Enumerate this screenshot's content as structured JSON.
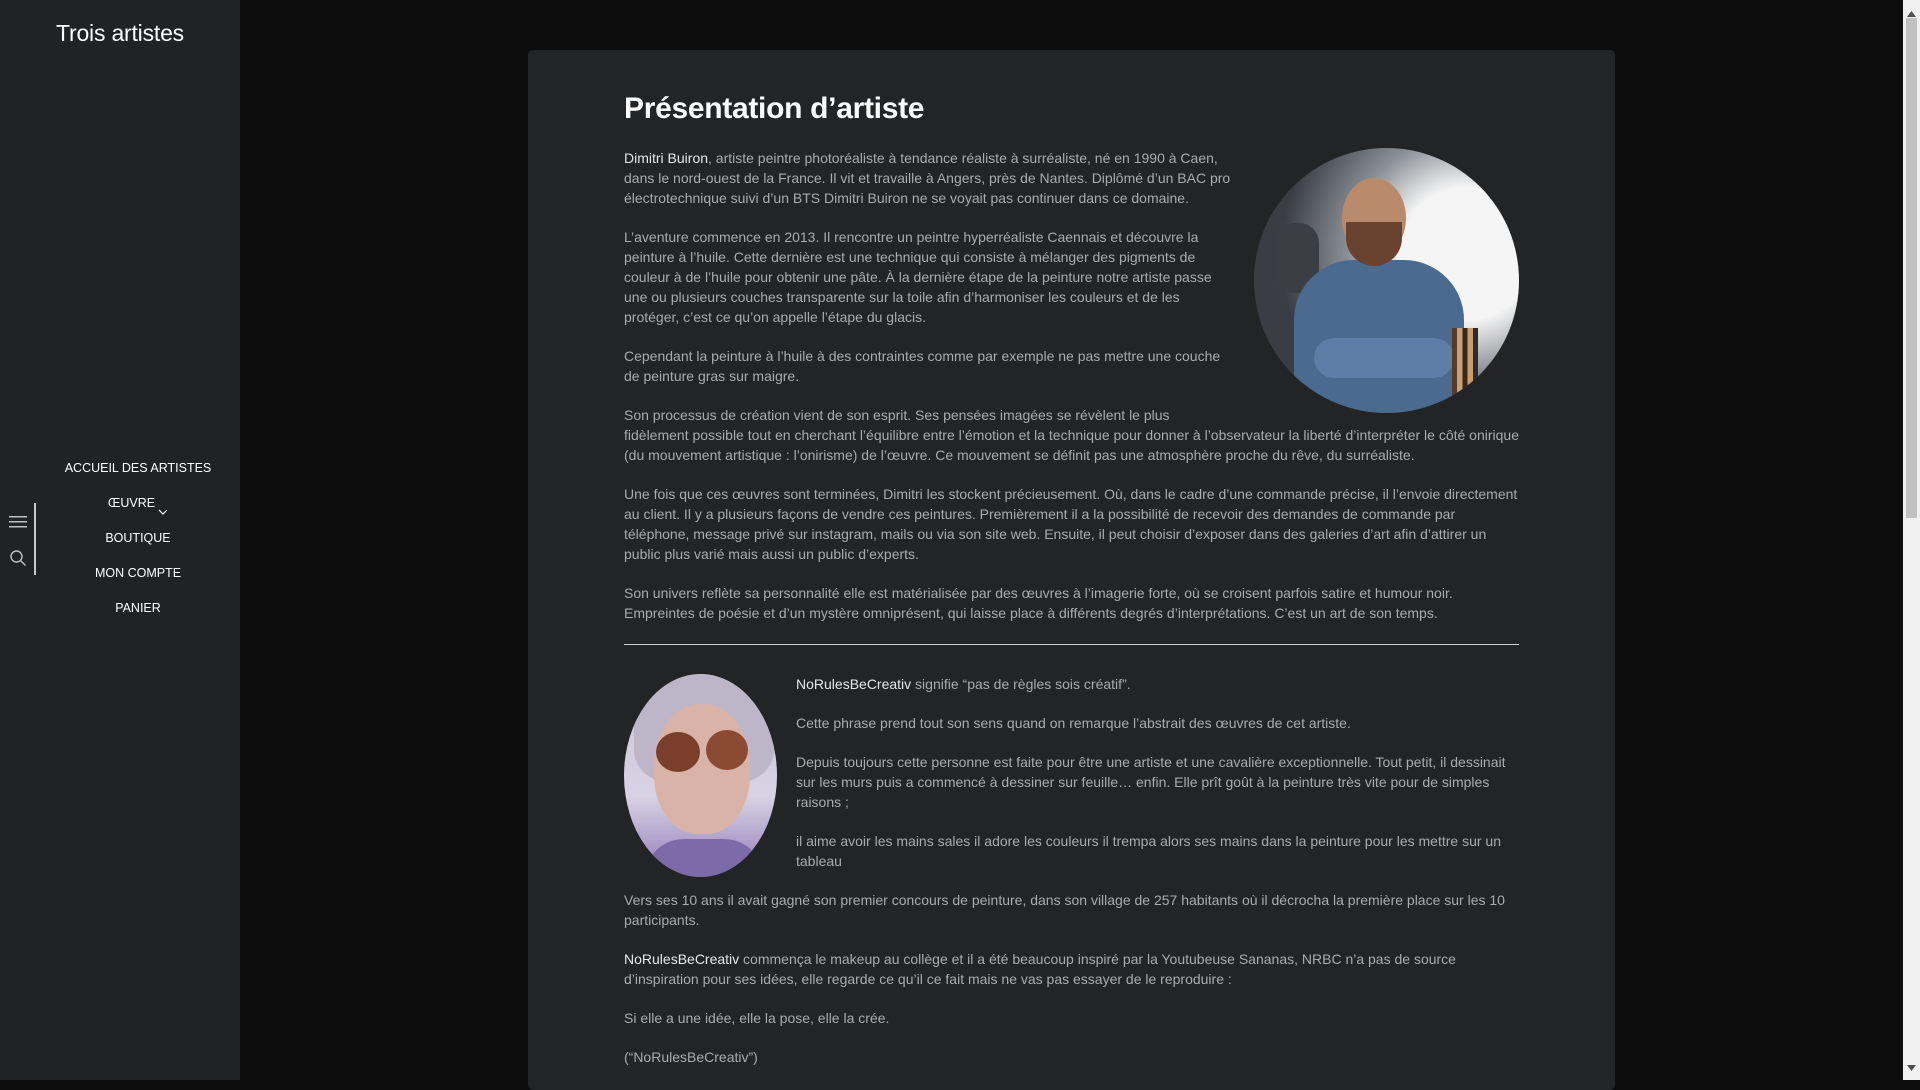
{
  "site": {
    "title": "Trois artistes"
  },
  "nav": {
    "items": [
      {
        "label": "ACCUEIL DES ARTISTES"
      },
      {
        "label": "ŒUVRE"
      },
      {
        "label": "BOUTIQUE"
      },
      {
        "label": "MON COMPTE"
      },
      {
        "label": "PANIER"
      }
    ]
  },
  "page": {
    "title": "Présentation d’artiste",
    "artist1": {
      "name": "Dimitri Buiron",
      "p1_rest": ", artiste peintre photoréaliste à tendance réaliste à surréaliste, né en 1990 à Caen, dans le nord-ouest de la France. Il vit et travaille à Angers, près de Nantes. Diplômé d’un BAC pro électrotechnique suivi d’un BTS Dimitri Buiron ne se voyait pas continuer dans ce domaine.",
      "p2": "L’aventure commence en 2013. Il rencontre un peintre hyperréaliste Caennais et découvre la peinture à l’huile. Cette dernière est une technique qui consiste à mélanger des pigments de couleur à de l’huile pour obtenir une pâte. À la dernière étape de la peinture notre artiste passe une ou plusieurs couches transparente sur la toile afin d’harmoniser les couleurs et de les protéger, c’est ce qu’on appelle l’étape du glacis.",
      "p3": "Cependant la peinture à l’huile à des contraintes comme par exemple ne pas mettre une couche de peinture gras sur maigre.",
      "p4": "Son processus de création vient de son esprit. Ses pensées imagées se révèlent le plus fidèlement possible tout en cherchant l’équilibre entre l’émotion et la technique pour donner à l’observateur la liberté d’interpréter le côté onirique (du mouvement artistique : l’onirisme) de l’œuvre. Ce mouvement se définit pas une atmosphère proche du rêve, du surréaliste.",
      "p5": "Une fois que ces œuvres sont terminées, Dimitri les stockent précieusement. Où, dans le cadre d’une commande précise, il l’envoie directement au client. Il y a plusieurs façons de vendre ces peintures. Premièrement il a la possibilité de recevoir des demandes de commande par téléphone, message privé sur instagram, mails ou via son site web. Ensuite, il peut choisir d’exposer dans des galeries d’art afin d’attirer un public plus varié mais aussi un public d’experts.",
      "p6": "Son univers reflète sa personnalité elle est matérialisée par des œuvres à l’imagerie forte, où se croisent parfois satire et humour noir. Empreintes de poésie et d’un mystère omniprésent, qui laisse place à différents degrés d’interprétations. C’est un art de son temps."
    },
    "artist2": {
      "name": "NoRulesBeCreativ",
      "p1_rest": " signifie “pas de règles sois créatif”.",
      "p2": "Cette phrase prend tout son sens quand on remarque l’abstrait des œuvres de cet artiste.",
      "p3": "Depuis toujours cette personne est faite pour être une artiste et une cavalière exceptionnelle. Tout petit, il dessinait sur les murs puis a commencé à dessiner sur feuille… enfin. Elle prît goût à la peinture très vite pour de simples raisons ;",
      "p4": "il aime avoir les mains sales il adore les couleurs il trempa alors ses mains dans la peinture pour les mettre sur un tableau",
      "p5": "Vers ses 10 ans il avait gagné son premier concours de peinture, dans son village de 257 habitants où il décrocha la première place sur les 10 participants.",
      "p6_name": "NoRulesBeCreativ",
      "p6_rest": " commença le makeup au collège et il a été beaucoup inspiré par la Youtubeuse Sananas, NRBC n’a pas de source d’inspiration pour ses idées, elle regarde ce qu’il ce fait mais ne vas pas essayer de le reproduire  :",
      "p7": "Si elle a une idée, elle la pose, elle la crée.",
      "p8": "(“NoRulesBeCreativ”)"
    }
  },
  "icons": {
    "menu": "hamburger-icon",
    "search": "search-icon",
    "dropdown": "chevron-down-icon"
  },
  "colors": {
    "page_bg": "#0c0c0c",
    "sidebar_bg": "#212224",
    "card_bg": "#222426",
    "text": "#a9acaf",
    "heading": "#ffffff"
  }
}
